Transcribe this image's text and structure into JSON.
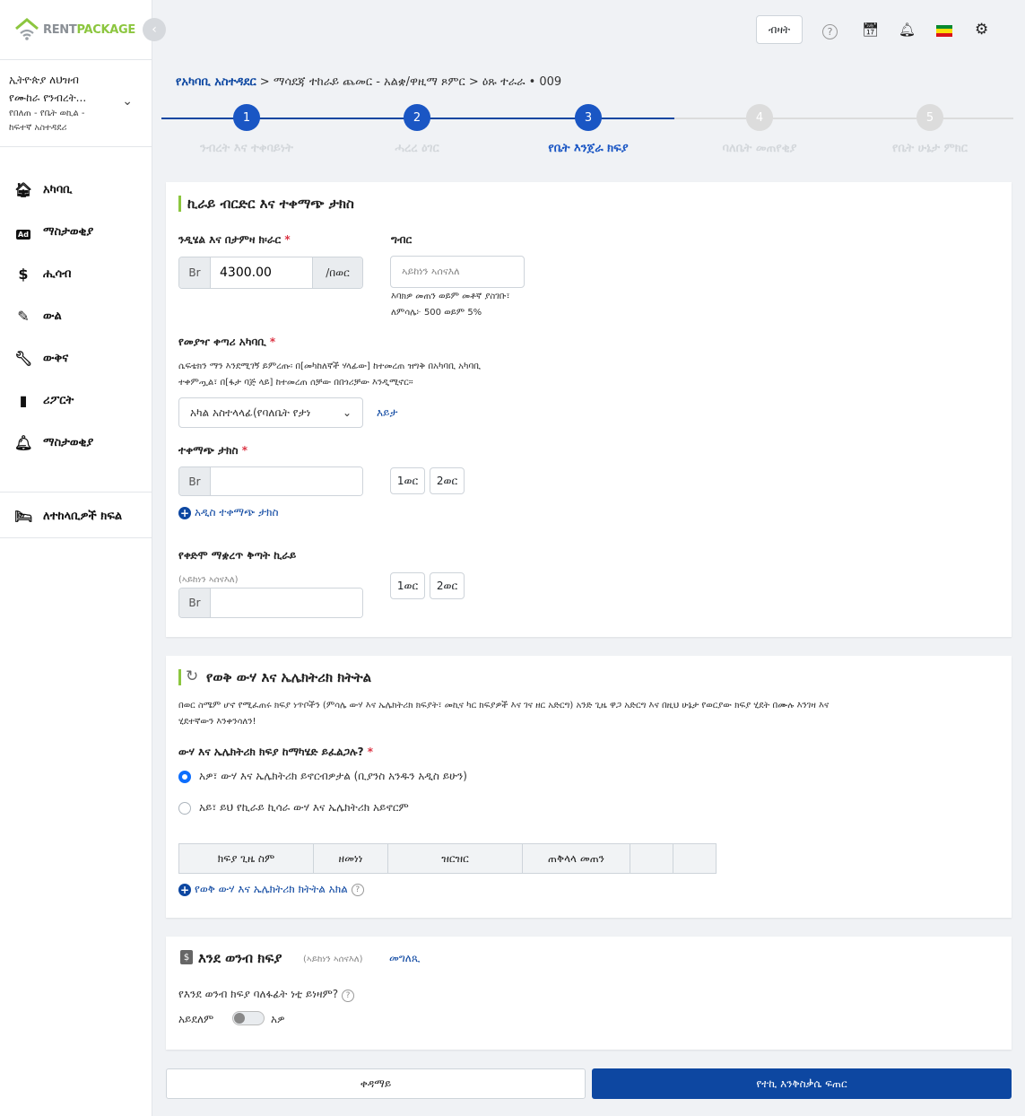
{
  "brand": {
    "part1": "RENT",
    "part2": "PACKAGE"
  },
  "org": {
    "line1": "ኢትዮጵያ ለህዝብ",
    "line2": "የሙከራ የንብረት...",
    "line3": "የበለጠ - የቤት ወኪል -",
    "line4": "ከፍተኛ አስተዳደሪ"
  },
  "nav": [
    "አካባቢ",
    "ማስታወቂያ",
    "ሒሳብ",
    "ውል",
    "ውቅና",
    "ሪፖርት",
    "ማስታወቂያ"
  ],
  "nav_bottom": "ለተከላቢዎች ክፍል",
  "topbar": {
    "lang_button": "ብዛት"
  },
  "breadcrumb": {
    "link": "የአካባቢ አስተዳደር",
    "rest": " > ማሳደጃ ተከራይ ጨመር - አልቋ/ዋዚማ ጾምር > ዕጹ ተራራ • 009"
  },
  "steps": [
    {
      "num": "1",
      "label": "ንብረት እና ተቀባይነት",
      "state": "done"
    },
    {
      "num": "2",
      "label": "ሓረረ ዕገር",
      "state": "done"
    },
    {
      "num": "3",
      "label": "የቤት እንጀራ ክፍያ",
      "state": "active"
    },
    {
      "num": "4",
      "label": "ባለቤት መጠየቂያ",
      "state": "pending"
    },
    {
      "num": "5",
      "label": "የቤት ሁኔታ ምክር",
      "state": "pending"
    }
  ],
  "rent": {
    "title": "ኪራይ ብርድር እና ተቀማጭ ታክስ",
    "amount_label": "ንዲሄል እና በታምዛ ክ፡ራር",
    "currency": "Br",
    "amount_value": "4300.00",
    "period": "/በወር",
    "tax_label": "ግብር",
    "tax_placeholder": "ኣይከነን ኣሰናእለ",
    "tax_help1": "እባክዎ መጠን ወይም መቶኛ ያስገቡ፣",
    "tax_help2": "ለምሳሌ፦ 500 ወይም 5%",
    "address_label": "የመያዣ ቀጣሪ አካባቢ",
    "address_help1": "ሴፍቴክን ማን እንደሚገኝ ይምረጡ፡ በ[መካከለኛች ሃላፊው] ከተመረጠ ዝግቅ በአካባቢ አካባቢ",
    "address_help2": "ተቀምጧል፣ በ[ፋታ ባጅ ላይ] ከተመረጠ ሰቻው በበጎሪቻው እንዲሚኖር።",
    "address_select": "አካል አስተላላፊ(የባለቤት የታነ",
    "address_view": "እይታ",
    "deposit_label": "ተቀማጭ ታክስ",
    "m1": "1ወር",
    "m2": "2ወር",
    "add_deposit": "አዲስ ተቀማጭ ታክስ",
    "prepaid_label": "የቀድሞ ማቋረጥ ቅጣት ኪራይ",
    "prepaid_hint": "(ኣይከነን ኣሰናእለ)"
  },
  "utility": {
    "title": "የወቅ ውሃ እና ኤሌክትሪክ ክትትል",
    "desc1": "በወር ስሜም ሆኖ የሚፈጠሩ ክፍያ ነጥቦችን (ምሳሌ ውሃ እና ኤሌክትሪክ ክፍያት፣ መኪና ካር ክፍያዎች እና ገና ዘር አድርግ) አንድ ጊዜ ዋጋ አድርግ እና በዚህ ሁኔታ የወርያው ክፍያ ሂደት በሙሉ እንገዛ እና",
    "desc2": "ሂደተኛውን እንቀንሳለን!",
    "question": "ውሃ እና ኤሌክትሪክ ክፍያ ከማካሄድ ይፈልጋሉ?",
    "opt_yes": "አዎ፣ ውሃ እና ኤሌክትሪክ ይኖርብዎታል (ቢያንስ አንዱን አዲስ ይሁን)",
    "opt_no": "አይ፣ ይህ የኪራይ ኪሳራ ውሃ እና ኤሌክትሪክ አይኖርም",
    "columns": [
      "ክፍያ ጊዜ ስም",
      "ዘመነነ",
      "ዝርዝር",
      "ጠቅላላ መጠን",
      "",
      ""
    ],
    "add": "የወቅ ውሃ እና ኤሌክትሪክ ክትትል አክል"
  },
  "advance": {
    "title": "እንደ ወንብ ክፍያ",
    "hint": "(ኣይከነን ኣሰናእለ)",
    "link": "መግለጺ",
    "question": "የእንደ ወንብ ክፍያ ባለፋፊት ነቲ ይነዛም?",
    "no": "አይደለም",
    "yes": "አዎ"
  },
  "footer": {
    "back": "ቀዳማይ",
    "next": "የተኪ እንቅስቃሴ ፍጠር"
  },
  "colors": {
    "primary": "#0d47a1",
    "active": "#1a56c4",
    "accent": "#8cc63f"
  }
}
